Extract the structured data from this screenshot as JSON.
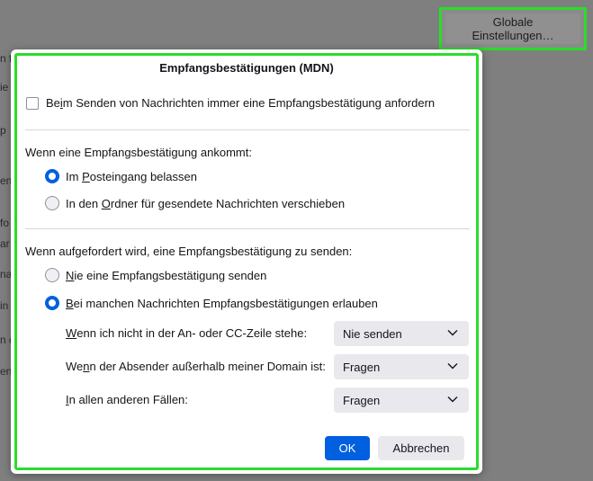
{
  "background": {
    "fragments": [
      "n f",
      "ie",
      "p",
      "en",
      "fo",
      "ar",
      "na",
      "in",
      "n c",
      "en"
    ],
    "global_settings_label": "Globale Einstellungen…"
  },
  "dialog": {
    "title": "Empfangsbestätigungen (MDN)",
    "always_request": {
      "pre": "Be",
      "key": "i",
      "post": "m Senden von Nachrichten immer eine Empfangsbestätigung anfordern",
      "checked": false
    },
    "incoming_heading": "Wenn eine Empfangsbestätigung ankommt:",
    "keep_inbox": {
      "pre": "Im ",
      "key": "P",
      "post": "osteingang belassen",
      "selected": true
    },
    "move_sent": {
      "pre": "In den ",
      "key": "O",
      "post": "rdner für gesendete Nachrichten verschieben",
      "selected": false
    },
    "request_heading": "Wenn aufgefordert wird, eine Empfangsbestätigung zu senden:",
    "never_send": {
      "pre": "",
      "key": "N",
      "post": "ie eine Empfangsbestätigung senden",
      "selected": false
    },
    "allow_some": {
      "pre": "",
      "key": "B",
      "post": "ei manchen Nachrichten Empfangsbestätigungen erlauben",
      "selected": true
    },
    "rules": [
      {
        "pre": "",
        "key": "W",
        "post": "enn ich nicht in der An- oder CC-Zeile stehe:",
        "value": "Nie senden"
      },
      {
        "pre": "We",
        "key": "n",
        "post": "n der Absender außerhalb meiner Domain ist:",
        "value": "Fragen"
      },
      {
        "pre": "",
        "key": "I",
        "post": "n allen anderen Fällen:",
        "value": "Fragen"
      }
    ],
    "ok_label": "OK",
    "cancel_label": "Abbrechen"
  },
  "colors": {
    "accent": "#0060df",
    "highlight": "#2bdc2b",
    "backdrop": "#7f7f7f"
  },
  "icons": [
    "chevron-down-icon"
  ]
}
